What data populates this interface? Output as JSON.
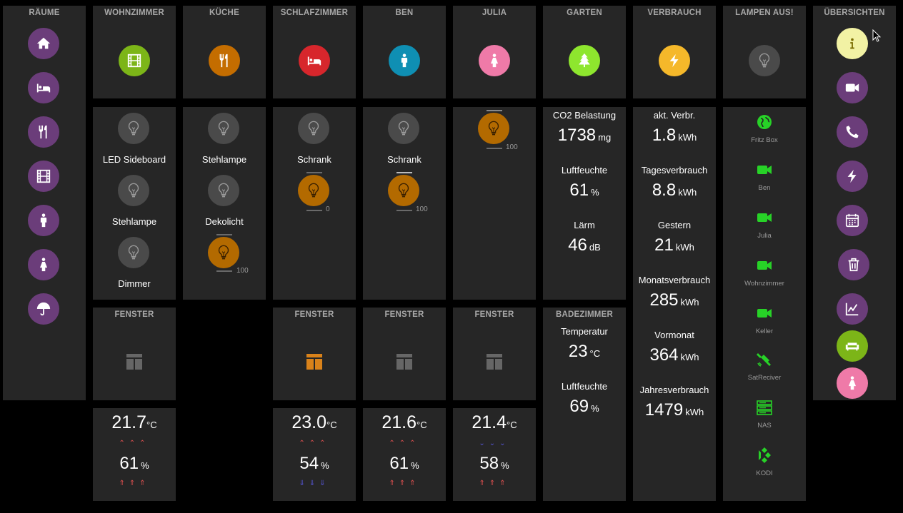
{
  "headers": {
    "raeume": "RÄUME",
    "wohnzimmer": "WOHNZIMMER",
    "kueche": "KÜCHE",
    "schlafzimmer": "SCHLAFZIMMER",
    "ben": "BEN",
    "julia": "JULIA",
    "garten": "GARTEN",
    "verbrauch": "VERBRAUCH",
    "lampen_aus": "LAMPEN AUS!",
    "uebersichten": "ÜBERSICHTEN",
    "fenster": "FENSTER",
    "badezimmer": "BADEZIMMER"
  },
  "colors": {
    "purple": "#6b3d7a",
    "wohnzimmer": "#7cb518",
    "kueche": "#c46d00",
    "schlafzimmer": "#d7262c",
    "ben": "#0f8fb3",
    "julia": "#ef7aa8",
    "garten": "#8ee62e",
    "verbrauch": "#f5b82a",
    "lamp_on": "#b36a00",
    "device_green": "#27d227",
    "arrow_red": "#e05050",
    "arrow_blue": "#5656d8"
  },
  "rooms_nav": [
    "home-icon",
    "bed-icon",
    "fork-knife-icon",
    "film-icon",
    "male-icon",
    "female-icon",
    "umbrella-icon"
  ],
  "lamps": {
    "wohnzimmer": [
      {
        "label": "LED Sideboard",
        "on": false
      },
      {
        "label": "Stehlampe",
        "on": false
      },
      {
        "label": "Dimmer",
        "on": false
      }
    ],
    "kueche": [
      {
        "label": "Stehlampe",
        "on": false
      },
      {
        "label": "Dekolicht",
        "on": true,
        "dim": "100"
      }
    ],
    "schlafzimmer": [
      {
        "label": "Schrank",
        "on": false
      },
      {
        "label": "",
        "on": true,
        "dim": "0"
      }
    ],
    "ben": [
      {
        "label": "Schrank",
        "on": false
      },
      {
        "label": "",
        "on": true,
        "dim": "100"
      }
    ],
    "julia": [
      {
        "label": "",
        "on": true,
        "dim": "100"
      }
    ]
  },
  "garten": [
    {
      "label": "CO2 Belastung",
      "value": "1738",
      "unit": "mg"
    },
    {
      "label": "Luftfeuchte",
      "value": "61",
      "unit": "%"
    },
    {
      "label": "Lärm",
      "value": "46",
      "unit": "dB"
    }
  ],
  "verbrauch": [
    {
      "label": "akt. Verbr.",
      "value": "1.8",
      "unit": "kWh"
    },
    {
      "label": "Tagesverbrauch",
      "value": "8.8",
      "unit": "kWh"
    },
    {
      "label": "Gestern",
      "value": "21",
      "unit": "kWh"
    },
    {
      "label": "Monatsverbrauch",
      "value": "285",
      "unit": "kWh"
    },
    {
      "label": "Vormonat",
      "value": "364",
      "unit": "kWh"
    },
    {
      "label": "Jahresverbrauch",
      "value": "1479",
      "unit": "kWh"
    }
  ],
  "badezimmer": [
    {
      "label": "Temperatur",
      "value": "23",
      "unit": "°C"
    },
    {
      "label": "Luftfeuchte",
      "value": "69",
      "unit": "%"
    }
  ],
  "devices": [
    {
      "name": "Fritz Box",
      "icon": "globe-icon"
    },
    {
      "name": "Ben",
      "icon": "camera-icon"
    },
    {
      "name": "Julia",
      "icon": "camera-icon"
    },
    {
      "name": "Wohnzimmer",
      "icon": "camera-icon"
    },
    {
      "name": "Keller",
      "icon": "camera-icon"
    },
    {
      "name": "SatReciver",
      "icon": "satellite-icon"
    },
    {
      "name": "NAS",
      "icon": "server-icon"
    },
    {
      "name": "KODI",
      "icon": "kodi-icon"
    }
  ],
  "uebersichten_icons": [
    "info-icon",
    "video-icon",
    "phone-icon",
    "bolt-icon",
    "calendar-icon",
    "trash-icon",
    "chart-icon",
    "sofa-icon",
    "female-icon"
  ],
  "climate": {
    "wohnzimmer": {
      "temp": "21.7",
      "temp_unit": "°C",
      "hum": "61",
      "hum_unit": "%",
      "temp_trend": "up",
      "hum_trend": "up"
    },
    "schlafzimmer": {
      "temp": "23.0",
      "temp_unit": "°C",
      "hum": "54",
      "hum_unit": "%",
      "temp_trend": "up",
      "hum_trend": "down"
    },
    "ben": {
      "temp": "21.6",
      "temp_unit": "°C",
      "hum": "61",
      "hum_unit": "%",
      "temp_trend": "up",
      "hum_trend": "up"
    },
    "julia": {
      "temp": "21.4",
      "temp_unit": "°C",
      "hum": "58",
      "hum_unit": "%",
      "temp_trend": "down",
      "hum_trend": "up"
    }
  },
  "window_open": {
    "wohnzimmer": false,
    "schlafzimmer": true,
    "ben": false,
    "julia": false
  }
}
